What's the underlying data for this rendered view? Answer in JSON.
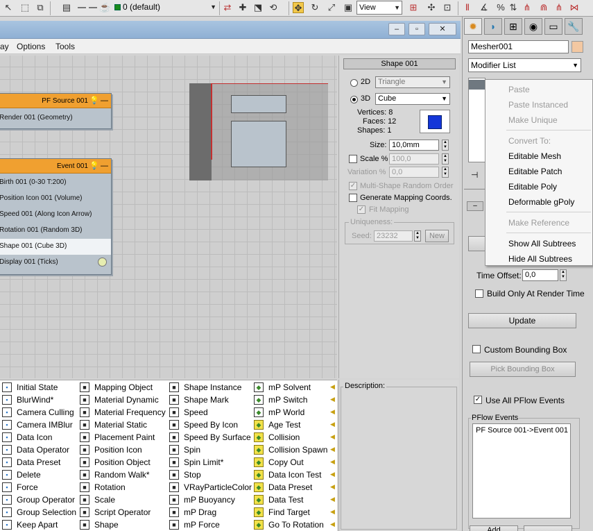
{
  "toolbar": {
    "layer": "0 (default)",
    "view": "View",
    "icons": [
      "select-icon",
      "rect-select-icon",
      "window-crossing-icon",
      "layer-manager-icon",
      "teapot-icon",
      "layer-color-icon",
      "link-icon",
      "move-icon",
      "rotate-icon",
      "scale-icon",
      "snap-icon",
      "percent-snap-icon",
      "spinner-snap-icon",
      "named-sets-icon",
      "mirror-icon",
      "align-icon",
      "curve-editor-icon",
      "schematic-icon"
    ]
  },
  "particle_view": {
    "menu": [
      "ay",
      "Options",
      "Tools"
    ],
    "nodes": {
      "pf_source": {
        "title": "PF Source 001",
        "rows": [
          "Render 001 (Geometry)"
        ]
      },
      "event": {
        "title": "Event 001",
        "rows": [
          "Birth 001 (0-30 T:200)",
          "Position Icon 001 (Volume)",
          "Speed 001 (Along Icon Arrow)",
          "Rotation 001 (Random 3D)",
          "Shape 001 (Cube 3D)",
          "Display 001 (Ticks)"
        ]
      }
    },
    "shape_panel": {
      "title": "Shape 001",
      "mode_2d": "2D",
      "value_2d": "Triangle",
      "mode_3d": "3D",
      "value_3d": "Cube",
      "vertices": "Vertices: 8",
      "faces": "Faces: 12",
      "shapes": "Shapes: 1",
      "size_label": "Size:",
      "size_value": "10,0mm",
      "scale_label": "Scale %",
      "scale_value": "100,0",
      "variation_label": "Variation %",
      "variation_value": "0,0",
      "multi_shape": "Multi-Shape Random Order",
      "gen_mapping": "Generate Mapping Coords.",
      "fit_mapping": "Fit Mapping",
      "uniqueness": "Uniqueness:",
      "seed_label": "Seed:",
      "seed_value": "23232",
      "new_label": "New"
    },
    "description_label": "Description:",
    "depot": {
      "col1": [
        "Initial State",
        "BlurWind*",
        "Camera Culling",
        "Camera IMBlur",
        "Data Icon",
        "Data Operator",
        "Data Preset",
        "Delete",
        "Force",
        "Group Operator",
        "Group Selection",
        "Keep Apart"
      ],
      "col2": [
        "Mapping Object",
        "Material Dynamic",
        "Material Frequency",
        "Material Static",
        "Placement Paint",
        "Position Icon",
        "Position Object",
        "Random Walk*",
        "Rotation",
        "Scale",
        "Script Operator",
        "Shape"
      ],
      "col3": [
        "Shape Instance",
        "Shape Mark",
        "Speed",
        "Speed By Icon",
        "Speed By Surface",
        "Spin",
        "Spin Limit*",
        "Stop",
        "VRayParticleColor",
        "mP Buoyancy",
        "mP Drag",
        "mP Force"
      ],
      "col4": [
        "mP Solvent",
        "mP Switch",
        "mP World",
        "Age Test",
        "Collision",
        "Collision Spawn",
        "Copy Out",
        "Data Icon Test",
        "Data Preset",
        "Data Test",
        "Find Target",
        "Go To Rotation"
      ]
    }
  },
  "command_panel": {
    "tabs": [
      "create-icon",
      "modify-icon",
      "hierarchy-icon",
      "motion-icon",
      "display-icon",
      "utilities-icon"
    ],
    "object_name": "Mesher001",
    "modifier_list": "Modifier List",
    "time_offset_label": "Time Offset:",
    "time_offset_value": "0,0",
    "build_only": "Build Only At Render Time",
    "update": "Update",
    "custom_bbox": "Custom Bounding Box",
    "pick_bbox": "Pick Bounding Box",
    "use_all": "Use All PFlow Events",
    "pflow_events_label": "PFlow Events",
    "pflow_event_item": "PF Source 001->Event 001",
    "add": "Add"
  },
  "context_menu": {
    "items_top": [
      "Paste",
      "Paste Instanced",
      "Make Unique"
    ],
    "convert_to": "Convert To:",
    "convert_items": [
      "Editable Mesh",
      "Editable Patch",
      "Editable Poly",
      "Deformable gPoly"
    ],
    "make_reference": "Make Reference",
    "subtree_items": [
      "Show All Subtrees",
      "Hide All Subtrees"
    ]
  }
}
